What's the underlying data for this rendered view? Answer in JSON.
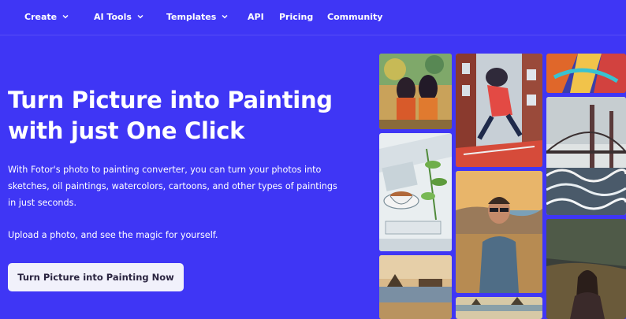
{
  "nav": {
    "items": [
      {
        "label": "Create",
        "dropdown": true
      },
      {
        "label": "AI Tools",
        "dropdown": true
      },
      {
        "label": "Templates",
        "dropdown": true
      },
      {
        "label": "API",
        "dropdown": false
      },
      {
        "label": "Pricing",
        "dropdown": false
      },
      {
        "label": "Community",
        "dropdown": false
      }
    ]
  },
  "hero": {
    "title_line1": "Turn Picture into Painting",
    "title_line2": "with just One Click",
    "description": "With Fotor's photo to painting converter, you can turn your photos into sketches, oil paintings, watercolors, cartoons, and other types of paintings in just seconds.",
    "upload_text": "Upload a photo, and see the magic for yourself.",
    "cta_label": "Turn Picture into Painting Now"
  },
  "gallery": {
    "tiles": [
      {
        "name": "two-girls-painting-tile",
        "icon": "painted-photo"
      },
      {
        "name": "skater-city-painting-tile",
        "icon": "painted-photo"
      },
      {
        "name": "abstract-colors-tile",
        "icon": "painted-photo"
      },
      {
        "name": "coffee-sketch-tile",
        "icon": "painted-photo"
      },
      {
        "name": "golden-gate-painting-tile",
        "icon": "painted-photo"
      },
      {
        "name": "man-sunglasses-painting-tile",
        "icon": "painted-photo"
      },
      {
        "name": "coast-painting-tile",
        "icon": "painted-photo"
      },
      {
        "name": "harbor-sketch-tile",
        "icon": "painted-photo"
      },
      {
        "name": "woman-night-painting-tile",
        "icon": "painted-photo"
      }
    ]
  },
  "colors": {
    "background": "#3f36f5",
    "cta_background": "#f1f1fb",
    "cta_text": "#2a2440"
  }
}
